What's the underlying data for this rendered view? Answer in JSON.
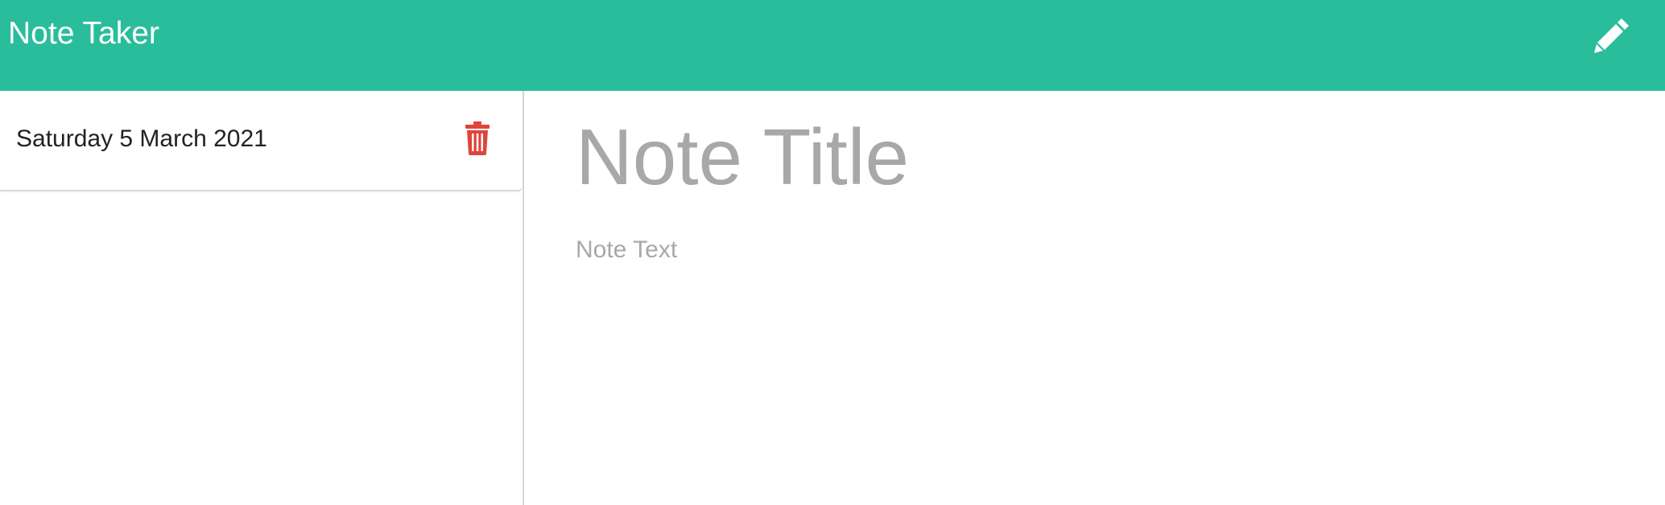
{
  "header": {
    "title": "Note Taker",
    "new_note_icon": "pencil-icon",
    "background_color": "#2abd9c"
  },
  "sidebar": {
    "notes": [
      {
        "title": "Saturday 5 March 2021",
        "delete_icon": "trash-icon",
        "delete_icon_color": "#e0453a"
      }
    ]
  },
  "editor": {
    "title_placeholder": "Note Title",
    "text_placeholder": "Note Text",
    "placeholder_color": "#a8a8a8"
  }
}
